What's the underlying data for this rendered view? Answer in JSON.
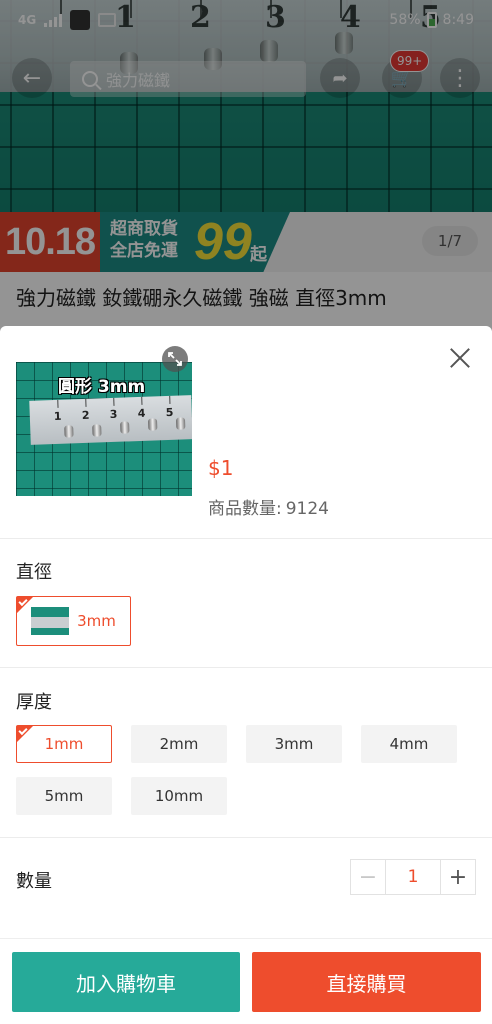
{
  "status_bar": {
    "network": "4G",
    "battery": "58%",
    "time": "8:49"
  },
  "header": {
    "search_placeholder": "強力磁鐵",
    "cart_badge": "99+"
  },
  "banner": {
    "promo_date": "10.18",
    "promo_line1": "超商取貨",
    "promo_line2": "全店免運",
    "promo_amount": "99",
    "promo_suffix": "起",
    "image_counter": "1/7"
  },
  "product": {
    "title": "強力磁鐵 釹鐵硼永久磁鐵 強磁  直徑3mm"
  },
  "sheet": {
    "thumbnail_label": "圓形 3mm",
    "thumbnail_ruler_numbers": [
      "1",
      "2",
      "3",
      "4",
      "5"
    ],
    "price": "$1",
    "stock_label": "商品數量:",
    "stock_value": "9124",
    "diameter": {
      "label": "直徑",
      "options": [
        {
          "label": "3mm",
          "selected": true
        }
      ]
    },
    "thickness": {
      "label": "厚度",
      "options": [
        {
          "label": "1mm",
          "selected": true
        },
        {
          "label": "2mm",
          "selected": false
        },
        {
          "label": "3mm",
          "selected": false
        },
        {
          "label": "4mm",
          "selected": false
        },
        {
          "label": "5mm",
          "selected": false
        },
        {
          "label": "10mm",
          "selected": false
        }
      ]
    },
    "quantity": {
      "label": "數量",
      "value": "1",
      "minus": "−",
      "plus": "+"
    }
  },
  "actions": {
    "add_to_cart": "加入購物車",
    "buy_now": "直接購買"
  },
  "colors": {
    "accent": "#ee4d2d",
    "teal": "#26aa99"
  },
  "icons": [
    "back-arrow-icon",
    "search-icon",
    "share-icon",
    "cart-icon",
    "more-icon",
    "expand-icon",
    "close-icon",
    "signal-icon",
    "image-icon",
    "battery-icon"
  ]
}
